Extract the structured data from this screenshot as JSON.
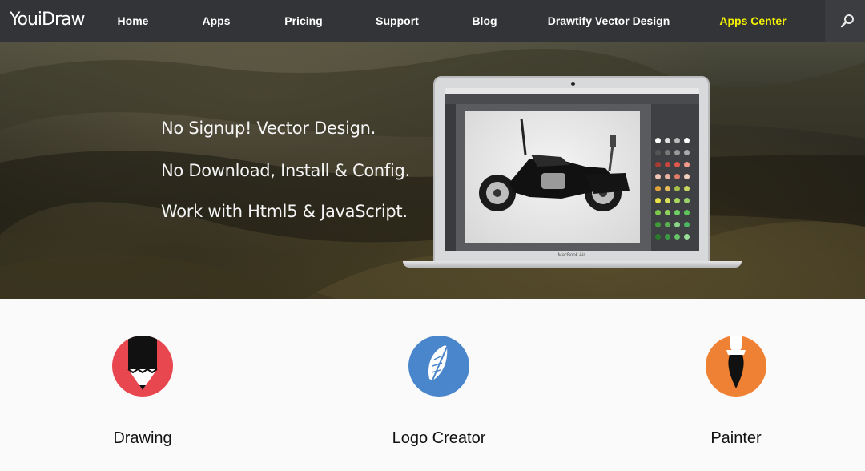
{
  "nav": {
    "logo": "YouiDraw",
    "items": [
      {
        "label": "Home",
        "highlight": false
      },
      {
        "label": "Apps",
        "highlight": false
      },
      {
        "label": "Pricing",
        "highlight": false
      },
      {
        "label": "Support",
        "highlight": false
      },
      {
        "label": "Blog",
        "highlight": false
      },
      {
        "label": "Drawtify Vector Design",
        "highlight": false
      },
      {
        "label": "Apps Center",
        "highlight": true
      }
    ],
    "search_icon": "search-icon"
  },
  "hero": {
    "taglines": [
      "No Signup! Vector Design.",
      "No Download, Install & Config.",
      "Work with Html5 & JavaScript."
    ],
    "laptop_label": "MacBook Air"
  },
  "features": [
    {
      "label": "Drawing",
      "icon": "pencil-icon",
      "color": "#e9474f"
    },
    {
      "label": "Logo Creator",
      "icon": "feather-icon",
      "color": "#4a86cc"
    },
    {
      "label": "Painter",
      "icon": "brush-icon",
      "color": "#ef8134"
    }
  ],
  "colors": {
    "nav_bg": "#333437",
    "highlight": "#f4f100"
  }
}
